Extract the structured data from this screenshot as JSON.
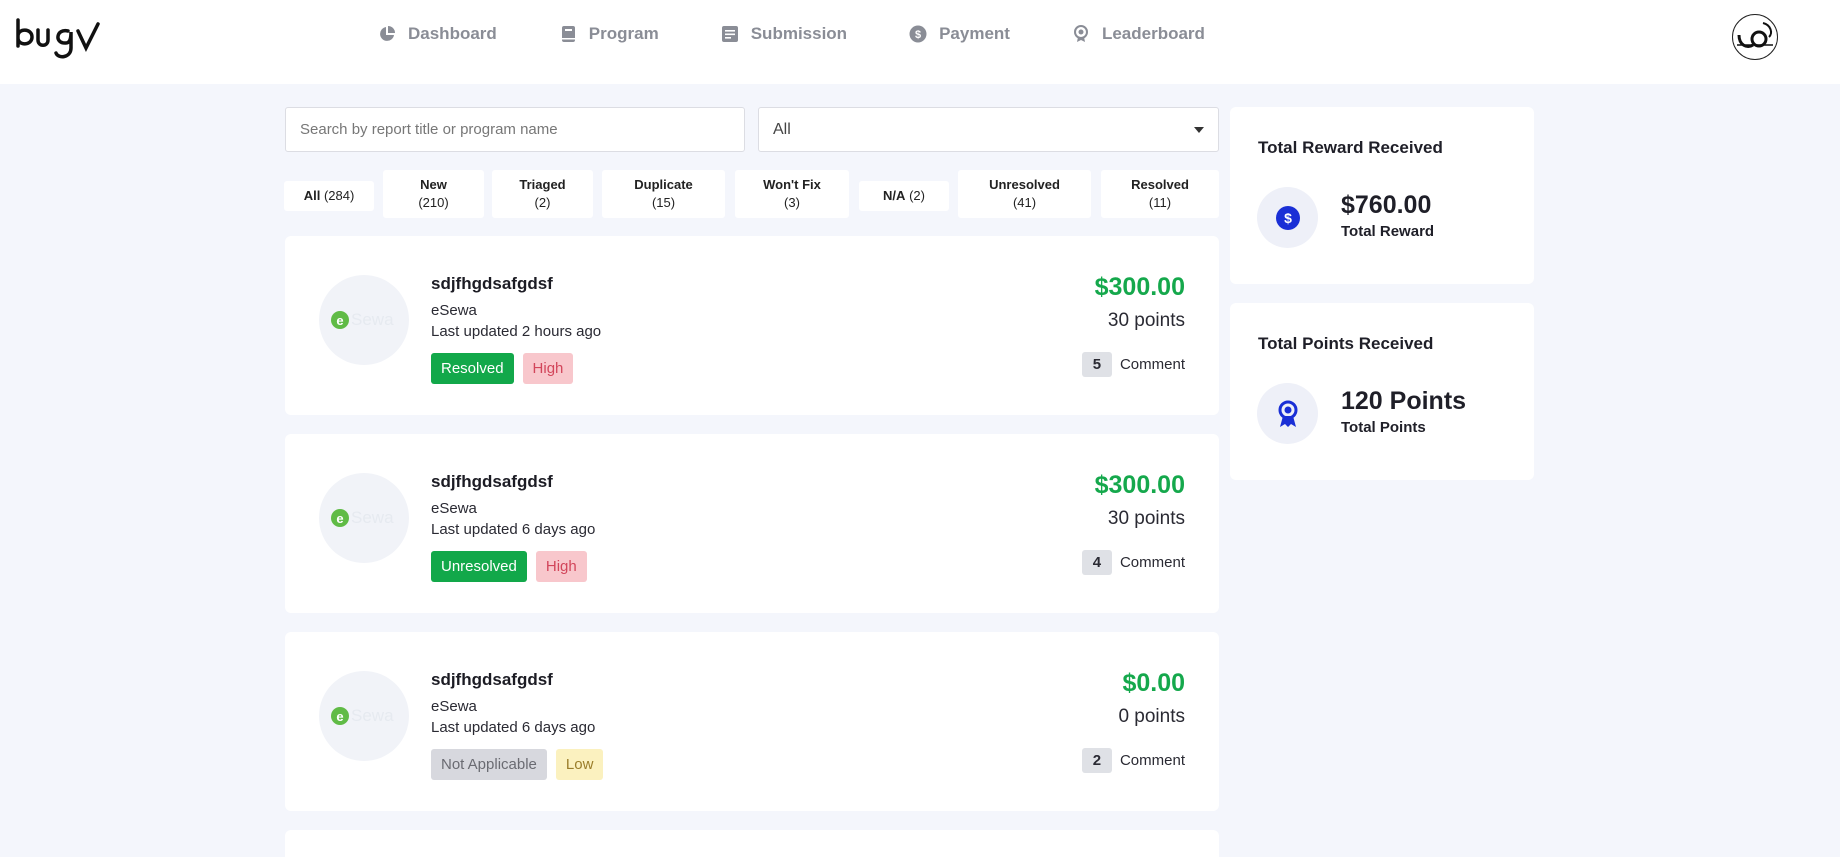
{
  "brand": {
    "logo_text": "bugv",
    "accent": "#1a2fd6",
    "green": "#15a84c"
  },
  "nav": [
    {
      "label": "Dashboard",
      "icon": "pie-chart-icon"
    },
    {
      "label": "Program",
      "icon": "book-icon"
    },
    {
      "label": "Submission",
      "icon": "document-icon"
    },
    {
      "label": "Payment",
      "icon": "dollar-coin-icon"
    },
    {
      "label": "Leaderboard",
      "icon": "medal-icon"
    }
  ],
  "user": {
    "avatar_icon": "user-avatar-icon"
  },
  "search": {
    "placeholder": "Search by report title or program name",
    "value": ""
  },
  "status_select": {
    "value": "All"
  },
  "filters": [
    {
      "label": "All",
      "count": "(284)"
    },
    {
      "label": "New",
      "count": "(210)"
    },
    {
      "label": "Triaged",
      "count": "(2)"
    },
    {
      "label": "Duplicate",
      "count": "(15)"
    },
    {
      "label": "Won't Fix",
      "count": "(3)"
    },
    {
      "label": "N/A",
      "count": "(2)"
    },
    {
      "label": "Unresolved",
      "count": "(41)"
    },
    {
      "label": "Resolved",
      "count": "(11)"
    }
  ],
  "reports": [
    {
      "title": "sdjfhgdsafgdsf",
      "program": "eSewa",
      "updated": "Last updated 2 hours ago",
      "status": "Resolved",
      "severity": "High",
      "amount": "$300.00",
      "points": "30 points",
      "comment_count": "5",
      "comment_label": "Comment"
    },
    {
      "title": "sdjfhgdsafgdsf",
      "program": "eSewa",
      "updated": "Last updated 6 days ago",
      "status": "Unresolved",
      "severity": "High",
      "amount": "$300.00",
      "points": "30 points",
      "comment_count": "4",
      "comment_label": "Comment"
    },
    {
      "title": "sdjfhgdsafgdsf",
      "program": "eSewa",
      "updated": "Last updated 6 days ago",
      "status": "Not Applicable",
      "severity": "Low",
      "amount": "$0.00",
      "points": "0 points",
      "comment_count": "2",
      "comment_label": "Comment"
    }
  ],
  "stats": {
    "reward": {
      "title": "Total Reward Received",
      "value": "$760.00",
      "label": "Total Reward",
      "icon": "dollar-circle-icon"
    },
    "points": {
      "title": "Total Points Received",
      "value": "120 Points",
      "label": "Total Points",
      "icon": "award-ribbon-icon"
    }
  }
}
